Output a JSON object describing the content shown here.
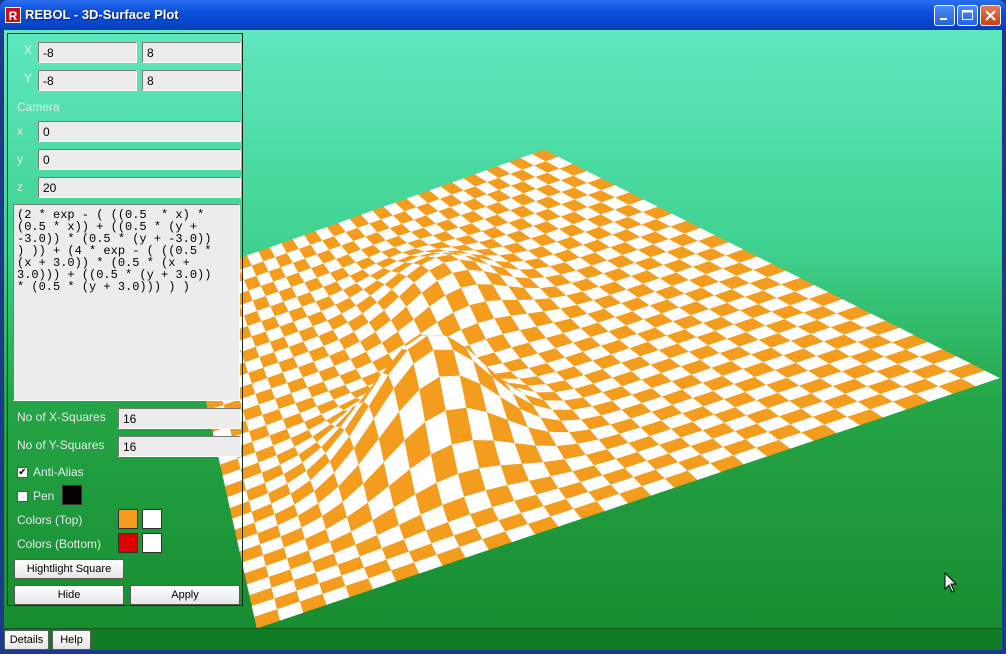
{
  "window": {
    "title": "REBOL - 3D-Surface Plot",
    "app_icon": "R"
  },
  "range": {
    "x_label": "X",
    "x_min": "-8",
    "x_max": "8",
    "y_label": "Y",
    "y_min": "-8",
    "y_max": "8"
  },
  "camera": {
    "heading": "Camera",
    "x_label": "x",
    "x_value": "0",
    "y_label": "y",
    "y_value": "0",
    "z_label": "z",
    "z_value": "20"
  },
  "formula": "(2 * exp - ( ((0.5  * x) *\n(0.5 * x)) + ((0.5 * (y +\n-3.0)) * (0.5 * (y + -3.0))\n) )) + (4 * exp - ( ((0.5 *\n(x + 3.0)) * (0.5 * (x +\n3.0))) + ((0.5 * (y + 3.0))\n* (0.5 * (y + 3.0))) ) )",
  "squares": {
    "x_label": "No of X-Squares",
    "x_value": "16",
    "y_label": "No of Y-Squares",
    "y_value": "16"
  },
  "options": {
    "anti_alias_label": "Anti-Alias",
    "anti_alias_checked": true,
    "pen_label": "Pen",
    "pen_checked": false,
    "pen_color": "#000000",
    "colors_top_label": "Colors (Top)",
    "colors_top": [
      "#f39c1e",
      "#ffffff"
    ],
    "colors_bottom_label": "Colors (Bottom)",
    "colors_bottom": [
      "#e00000",
      "#ffffff"
    ]
  },
  "buttons": {
    "highlight": "Hightlight Square",
    "hide": "Hide",
    "apply": "Apply",
    "details": "Details",
    "help": "Help"
  },
  "icons": {
    "minimize": "minimize-icon",
    "maximize": "maximize-icon",
    "close": "close-icon",
    "cursor": "cursor-icon"
  },
  "colors": {
    "tile_a": "#f39c1e",
    "tile_b": "#ffffff"
  }
}
